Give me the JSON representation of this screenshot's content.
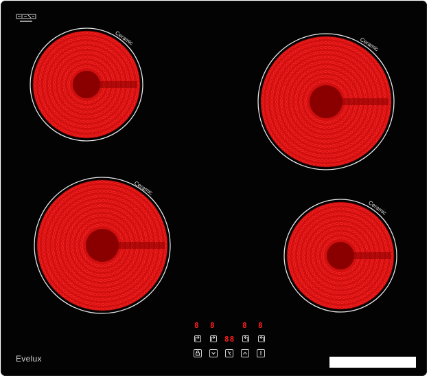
{
  "hob": {
    "brand": "Evelux",
    "zone_label": "Ceramic",
    "colors": {
      "glass": "#030303",
      "coil": "#d10f0f",
      "coil_bright": "#ff2a2a",
      "center": "#8a0000",
      "ring": "#e8e8e8",
      "display": "#ff1e1e"
    }
  },
  "zones": [
    {
      "name": "rear-left",
      "label": "Ceramic"
    },
    {
      "name": "rear-right",
      "label": "Ceramic"
    },
    {
      "name": "front-left",
      "label": "Ceramic"
    },
    {
      "name": "front-right",
      "label": "Ceramic"
    }
  ],
  "controls": {
    "displays": [
      "8",
      "8",
      "88",
      "8",
      "8"
    ],
    "top_keys": [
      "power-left-icon",
      "power-left-icon",
      "timer-display",
      "power-right-icon",
      "power-right-icon"
    ],
    "bottom_buttons": [
      "lock-icon",
      "minus-icon",
      "timer-icon",
      "plus-icon",
      "power-icon"
    ]
  }
}
